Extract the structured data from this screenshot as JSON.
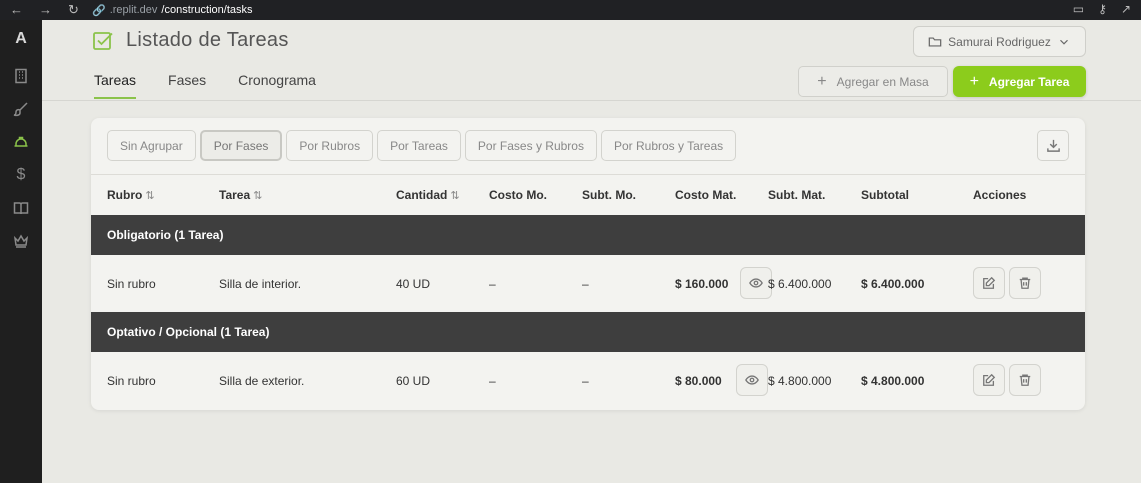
{
  "browser": {
    "url_host": ".replit.dev",
    "url_path": "/construction/tasks"
  },
  "sidebar": {
    "logo": "A",
    "items": [
      {
        "icon": "building-icon"
      },
      {
        "icon": "brush-icon"
      },
      {
        "icon": "hard-hat-icon",
        "active": true
      },
      {
        "icon": "dollar-icon"
      },
      {
        "icon": "book-icon"
      },
      {
        "icon": "crown-icon"
      }
    ],
    "dollar_glyph": "$"
  },
  "header": {
    "title": "Listado de Tareas",
    "user": "Samurai Rodriguez",
    "tabs": [
      "Tareas",
      "Fases",
      "Cronograma"
    ],
    "active_tab": "Tareas",
    "bulk_add_label": "Agregar en Masa",
    "add_task_label": "Agregar Tarea",
    "accent_color": "#8ccc1c"
  },
  "grouping": {
    "options": [
      "Sin Agrupar",
      "Por Fases",
      "Por Rubros",
      "Por Tareas",
      "Por Fases y Rubros",
      "Por Rubros y Tareas"
    ],
    "selected": "Por Fases"
  },
  "table": {
    "columns": {
      "rubro": "Rubro",
      "tarea": "Tarea",
      "cantidad": "Cantidad",
      "costo_mo": "Costo Mo.",
      "subt_mo": "Subt. Mo.",
      "costo_mat": "Costo Mat.",
      "subt_mat": "Subt. Mat.",
      "subtotal": "Subtotal",
      "acciones": "Acciones"
    },
    "sort_glyph": "⇅",
    "groups": [
      {
        "label": "Obligatorio (1 Tarea)",
        "row": {
          "rubro": "Sin rubro",
          "tarea": "Silla de interior.",
          "cantidad": "40 UD",
          "costo_mo": "–",
          "subt_mo": "–",
          "costo_mat": "$ 160.000",
          "subt_mat": "$ 6.400.000",
          "subtotal": "$ 6.400.000"
        }
      },
      {
        "label": "Optativo / Opcional (1 Tarea)",
        "row": {
          "rubro": "Sin rubro",
          "tarea": "Silla de exterior.",
          "cantidad": "60 UD",
          "costo_mo": "–",
          "subt_mo": "–",
          "costo_mat": "$ 80.000",
          "subt_mat": "$ 4.800.000",
          "subtotal": "$ 4.800.000"
        }
      }
    ]
  }
}
